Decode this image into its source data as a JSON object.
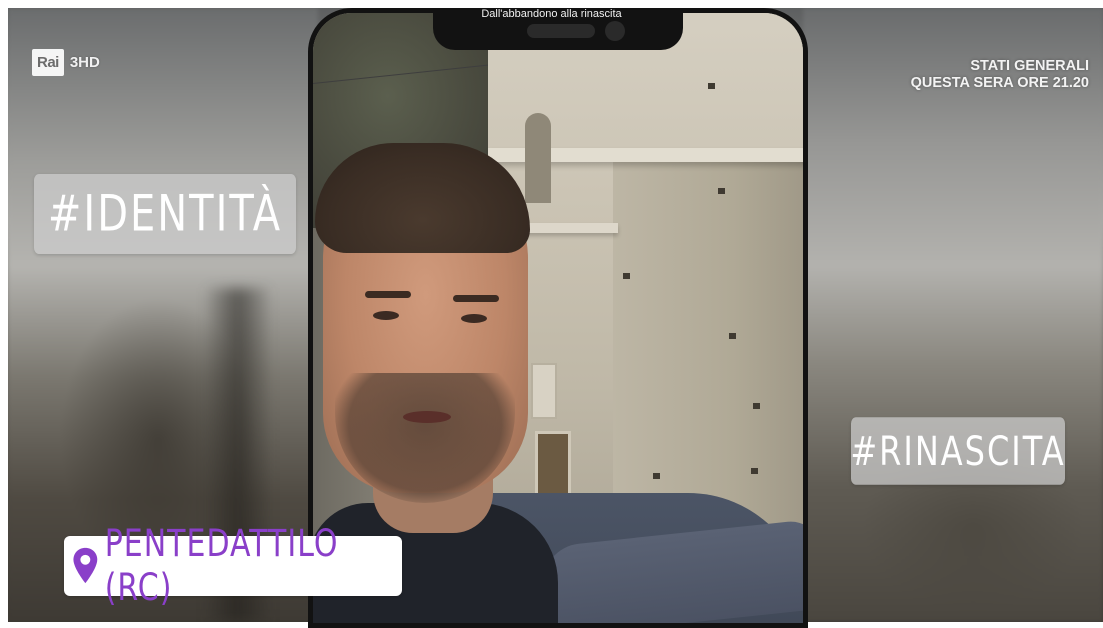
{
  "broadcast": {
    "program_title": "Dall'abbandono alla rinascita",
    "channel": {
      "logo_text": "Rai",
      "suffix": "3HD"
    },
    "promo": {
      "line1": "STATI GENERALI",
      "line2": "QUESTA SERA ORE 21.20"
    }
  },
  "stickers": {
    "hashtag_left": "#IDENTITÀ",
    "hashtag_right": "#RINASCITA",
    "location": {
      "label": "PENTEDATTILO (RC)",
      "icon": "location-pin-icon",
      "color": "#8a3fc9"
    }
  },
  "colors": {
    "phone_frame": "#121212",
    "sticker_bg": "#ffffff",
    "hashtag_bg": "#cdcdcd"
  }
}
